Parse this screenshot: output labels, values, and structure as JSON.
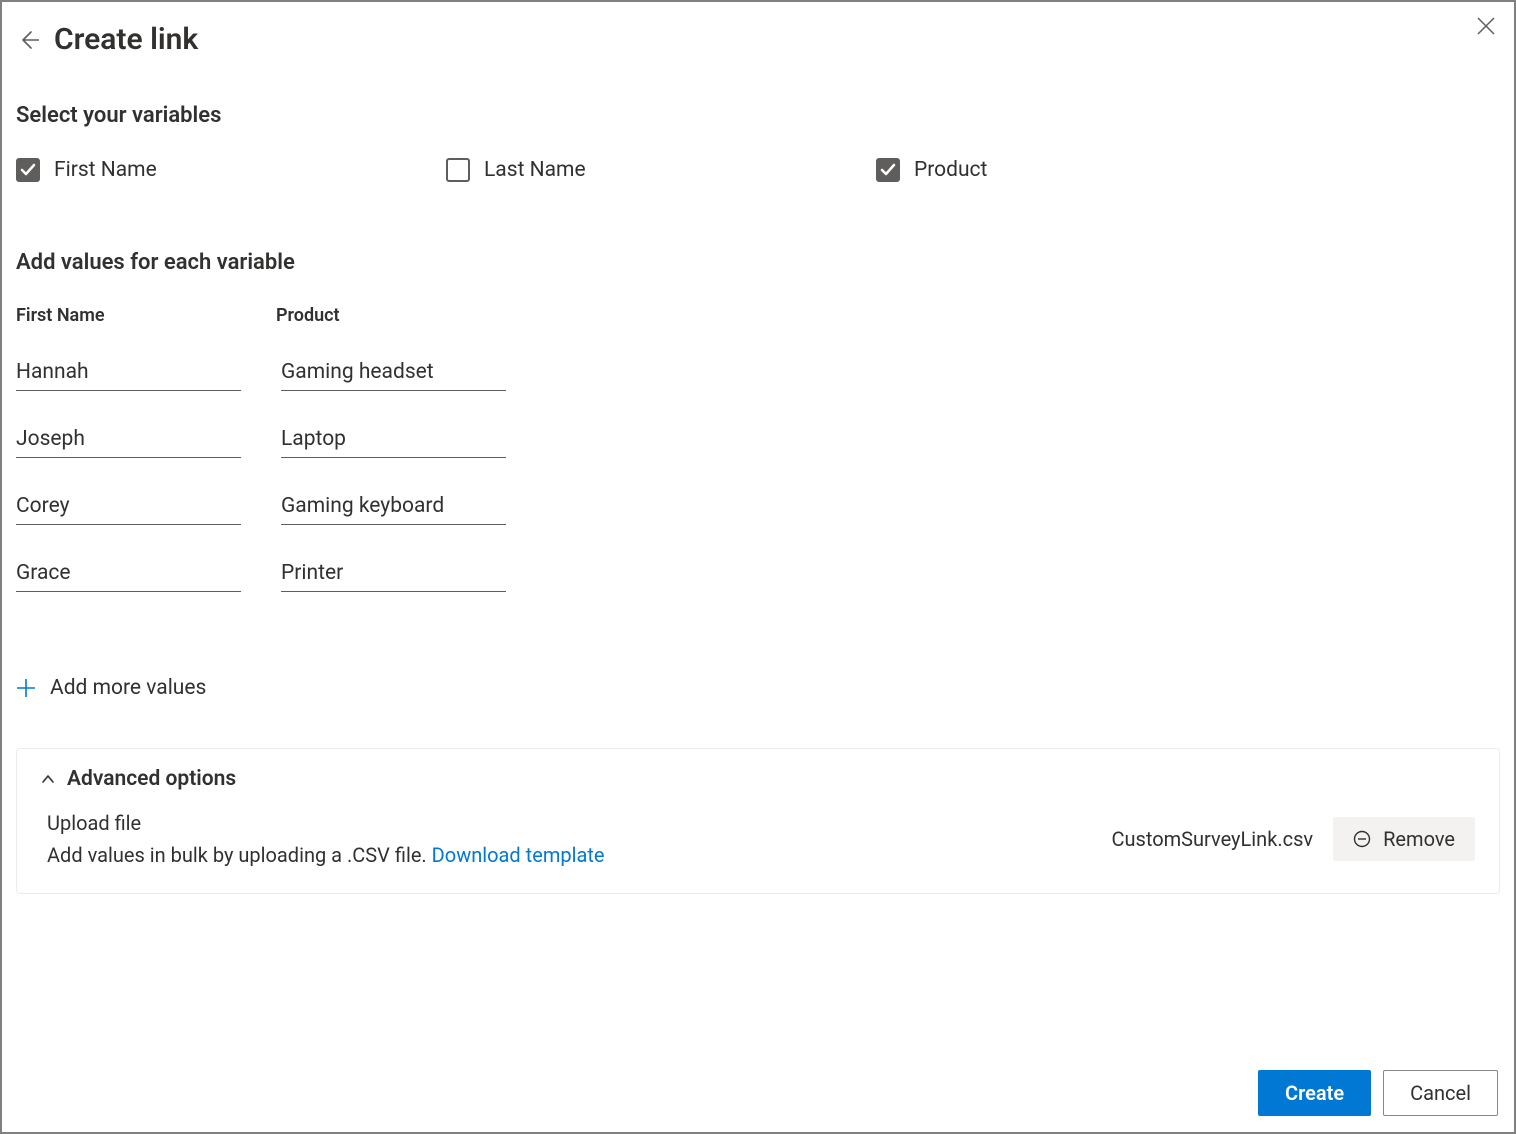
{
  "header": {
    "title": "Create link"
  },
  "section1": {
    "heading": "Select your variables",
    "variables": [
      {
        "label": "First Name",
        "checked": true
      },
      {
        "label": "Last Name",
        "checked": false
      },
      {
        "label": "Product",
        "checked": true
      }
    ]
  },
  "section2": {
    "heading": "Add values for each variable",
    "columns": [
      "First Name",
      "Product"
    ],
    "rows": [
      {
        "firstName": "Hannah",
        "product": "Gaming headset"
      },
      {
        "firstName": "Joseph",
        "product": "Laptop"
      },
      {
        "firstName": "Corey",
        "product": "Gaming keyboard"
      },
      {
        "firstName": "Grace",
        "product": "Printer"
      }
    ],
    "addMoreLabel": "Add more values"
  },
  "advanced": {
    "title": "Advanced options",
    "uploadTitle": "Upload file",
    "uploadDesc": "Add values in bulk by uploading a .CSV file. ",
    "downloadLink": "Download template",
    "fileName": "CustomSurveyLink.csv",
    "removeLabel": "Remove"
  },
  "footer": {
    "create": "Create",
    "cancel": "Cancel"
  }
}
